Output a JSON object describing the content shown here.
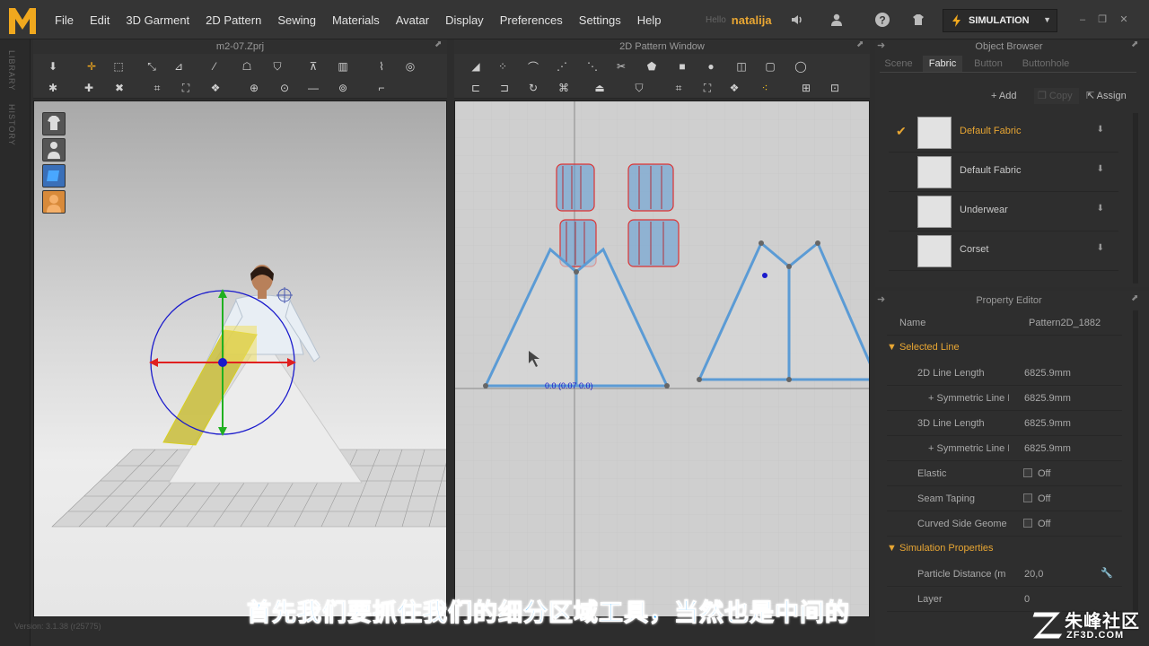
{
  "menubar": {
    "items": [
      "File",
      "Edit",
      "3D Garment",
      "2D Pattern",
      "Sewing",
      "Materials",
      "Avatar",
      "Display",
      "Preferences",
      "Settings",
      "Help"
    ],
    "hello": "Hello",
    "username": "natalija",
    "simulation_label": "SIMULATION"
  },
  "side_tabs": [
    "LIBRARY",
    "HISTORY"
  ],
  "panel3d": {
    "title": "m2-07.Zprj"
  },
  "panel2d": {
    "title": "2D Pattern Window",
    "coord_label": "0.0 (0.07 0.0)"
  },
  "object_browser": {
    "title": "Object Browser",
    "tabs": [
      "Scene",
      "Fabric",
      "Button",
      "Buttonhole"
    ],
    "active_tab": "Fabric",
    "buttons": {
      "add": "Add",
      "copy": "Copy",
      "assign": "Assign"
    },
    "fabrics": [
      "Default Fabric",
      "Default Fabric",
      "Underwear",
      "Corset"
    ],
    "selected_index": 0
  },
  "property_editor": {
    "title": "Property Editor",
    "name_label": "Name",
    "name_value": "Pattern2D_1882",
    "selected_line": {
      "heading": "Selected Line",
      "rows": [
        {
          "label": "2D Line Length",
          "value": "6825.9mm"
        },
        {
          "label": "+ Symmetric Line Le",
          "value": "6825.9mm"
        },
        {
          "label": "3D Line Length",
          "value": "6825.9mm"
        },
        {
          "label": "+ Symmetric Line Le",
          "value": "6825.9mm"
        },
        {
          "label": "Elastic",
          "value": "Off"
        },
        {
          "label": "Seam Taping",
          "value": "Off"
        },
        {
          "label": "Curved Side Geome",
          "value": "Off"
        }
      ]
    },
    "simulation": {
      "heading": "Simulation Properties",
      "rows": [
        {
          "label": "Particle Distance (m",
          "value": "20,0"
        },
        {
          "label": "Layer",
          "value": "0"
        }
      ]
    }
  },
  "subtitle": "首先我们要抓住我们的细分区域工具，当然也是中间的",
  "watermark": {
    "brand": "朱峰社区",
    "url": "ZF3D.COM"
  },
  "version": "Version: 3.1.38 (r25775)",
  "colors": {
    "accent": "#e8a633",
    "subtitle": "#2fa8ff",
    "pattern_line": "#5b9bd5"
  }
}
